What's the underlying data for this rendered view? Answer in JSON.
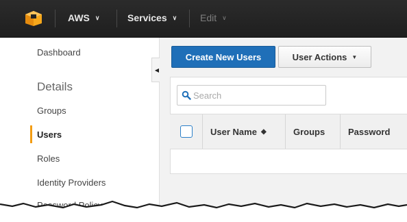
{
  "nav": {
    "logo_icon": "aws-cube-icon",
    "aws_label": "AWS",
    "services_label": "Services",
    "edit_label": "Edit",
    "caret_glyph": "∨"
  },
  "sidebar": {
    "dashboard": "Dashboard",
    "details_heading": "Details",
    "items": [
      {
        "label": "Groups",
        "active": false
      },
      {
        "label": "Users",
        "active": true
      },
      {
        "label": "Roles",
        "active": false
      },
      {
        "label": "Identity Providers",
        "active": false
      },
      {
        "label": "Password Policy",
        "active": false
      }
    ],
    "collapse_glyph": "◀",
    "active_color": "#f39c12"
  },
  "toolbar": {
    "create_label": "Create New Users",
    "actions_label": "User Actions",
    "actions_caret": "▼",
    "primary_color": "#1f6fb8"
  },
  "search": {
    "placeholder": "Search",
    "value": ""
  },
  "table": {
    "columns": [
      {
        "label": "",
        "type": "checkbox"
      },
      {
        "label": "User Name",
        "sortable": true
      },
      {
        "label": "Groups"
      },
      {
        "label": "Password"
      }
    ],
    "sort_glyph": "◆"
  }
}
